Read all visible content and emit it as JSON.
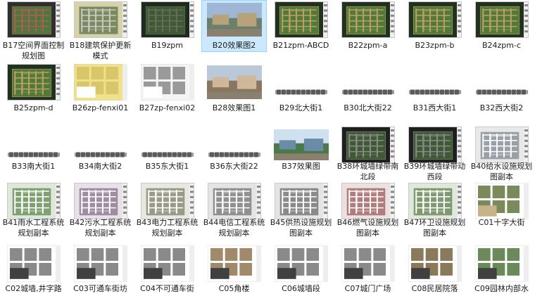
{
  "items": [
    {
      "label": "B17空间界面控制规划图",
      "type": "plan",
      "colors": [
        "#2f2f2f",
        "#4a7a3a",
        "#b05a5a"
      ]
    },
    {
      "label": "B18建筑保护更新模式",
      "type": "plan",
      "colors": [
        "#d8d2a8",
        "#7a8a5a",
        "#c9c9c9"
      ]
    },
    {
      "label": "B19zpm",
      "type": "plan",
      "colors": [
        "#1f2a1f",
        "#3c5a34",
        "#6b6b5a"
      ]
    },
    {
      "label": "B20效果图2",
      "type": "photo",
      "colors": [
        "#9eb7d6",
        "#6b7f6a",
        "#b8a27c"
      ]
    },
    {
      "label": "B21zpm-ABCD",
      "type": "plan",
      "colors": [
        "#22301f",
        "#4f7a3c",
        "#c0a060"
      ]
    },
    {
      "label": "B22zpm-a",
      "type": "plan",
      "colors": [
        "#22301f",
        "#4f7a3c",
        "#c0a060"
      ]
    },
    {
      "label": "B23zpm-b",
      "type": "plan",
      "colors": [
        "#22301f",
        "#4f7a3c",
        "#c0a060"
      ]
    },
    {
      "label": "B24zpm-c",
      "type": "plan",
      "colors": [
        "#22301f",
        "#4f7a3c",
        "#c0a060"
      ]
    },
    {
      "label": "B25zpm-d",
      "type": "plan",
      "colors": [
        "#22301f",
        "#4f7a3c",
        "#c0a060"
      ]
    },
    {
      "label": "B26zp-fenxi01",
      "type": "doc",
      "colors": [
        "#f1e08a",
        "#d9c56a",
        "#ffffff"
      ]
    },
    {
      "label": "B27zp-fenxi02",
      "type": "doc",
      "colors": [
        "#f4f4f4",
        "#9a9a9a",
        "#ffffff"
      ]
    },
    {
      "label": "B28效果图1",
      "type": "photo",
      "colors": [
        "#b9c9d9",
        "#8a7560",
        "#cfb89a"
      ]
    },
    {
      "label": "B29北大街1",
      "type": "strip",
      "colors": [
        "#ffffff",
        "#9a9a9a",
        "#5a5a5a"
      ]
    },
    {
      "label": "B30北大街22",
      "type": "strip",
      "colors": [
        "#ffffff",
        "#9a9a9a",
        "#5a5a5a"
      ]
    },
    {
      "label": "B31西大街1",
      "type": "strip",
      "colors": [
        "#ffffff",
        "#9a9a9a",
        "#5a5a5a"
      ]
    },
    {
      "label": "B32西大街2",
      "type": "strip",
      "colors": [
        "#ffffff",
        "#9a9a9a",
        "#5a5a5a"
      ]
    },
    {
      "label": "B33南大街1",
      "type": "strip",
      "colors": [
        "#ffffff",
        "#9a9a9a",
        "#5a5a5a"
      ]
    },
    {
      "label": "B34南大街2",
      "type": "strip",
      "colors": [
        "#ffffff",
        "#9a9a9a",
        "#5a5a5a"
      ]
    },
    {
      "label": "B35东大街1",
      "type": "strip",
      "colors": [
        "#ffffff",
        "#9a9a9a",
        "#5a5a5a"
      ]
    },
    {
      "label": "B36东大街22",
      "type": "strip",
      "colors": [
        "#ffffff",
        "#9a9a9a",
        "#5a5a5a"
      ]
    },
    {
      "label": "B37效果图",
      "type": "photo",
      "colors": [
        "#cfe0ee",
        "#4a7a4a",
        "#6a8ca8"
      ]
    },
    {
      "label": "B38环城墙绿带南北段",
      "type": "plan",
      "colors": [
        "#1f1f1f",
        "#3e5a34",
        "#8a8a8a"
      ]
    },
    {
      "label": "B39环城墙绿带动西段",
      "type": "plan",
      "colors": [
        "#1f1f1f",
        "#3e5a34",
        "#8a8a8a"
      ]
    },
    {
      "label": "B40给水设施规划图副本",
      "type": "plan",
      "colors": [
        "#e8e8e8",
        "#9aa0a8",
        "#ffffff"
      ]
    },
    {
      "label": "B41雨水工程系统规划副本",
      "type": "plan",
      "colors": [
        "#dfe8d8",
        "#7fa070",
        "#ffffff"
      ]
    },
    {
      "label": "B42污水工程系统规划副本",
      "type": "plan",
      "colors": [
        "#e8e0e8",
        "#a08ca0",
        "#ffffff"
      ]
    },
    {
      "label": "B43电力工程系统规划副本",
      "type": "plan",
      "colors": [
        "#e8e8e0",
        "#9a9a88",
        "#ffffff"
      ]
    },
    {
      "label": "B44电信工程系统规划副本",
      "type": "plan",
      "colors": [
        "#e4e4e4",
        "#909090",
        "#ffffff"
      ]
    },
    {
      "label": "B45供热设施规划图副本",
      "type": "plan",
      "colors": [
        "#e4e4e4",
        "#8a8a8a",
        "#ffffff"
      ]
    },
    {
      "label": "B46燃气设施规划图副本",
      "type": "plan",
      "colors": [
        "#ece0e0",
        "#b07c7c",
        "#ffffff"
      ]
    },
    {
      "label": "B47环卫设施规划图副本",
      "type": "plan",
      "colors": [
        "#e0e8dc",
        "#7f9a70",
        "#ffffff"
      ]
    },
    {
      "label": "C01十字大街",
      "type": "doc",
      "colors": [
        "#ffffff",
        "#7a8a5a",
        "#c8b28a"
      ]
    },
    {
      "label": "C02城墙,井字路",
      "type": "doc",
      "colors": [
        "#ffffff",
        "#8a8a8a",
        "#404040"
      ]
    },
    {
      "label": "C03可通车街坊",
      "type": "doc",
      "colors": [
        "#ffffff",
        "#8a8a8a",
        "#404040"
      ]
    },
    {
      "label": "C04不可通车街",
      "type": "doc",
      "colors": [
        "#ffffff",
        "#8a8a8a",
        "#404040"
      ]
    },
    {
      "label": "C05角楼",
      "type": "doc",
      "colors": [
        "#ffffff",
        "#a08a6a",
        "#404040"
      ]
    },
    {
      "label": "C06城墙段",
      "type": "doc",
      "colors": [
        "#ffffff",
        "#8a8a8a",
        "#404040"
      ]
    },
    {
      "label": "C07城门广场",
      "type": "doc",
      "colors": [
        "#ffffff",
        "#8a8a8a",
        "#404040"
      ]
    },
    {
      "label": "C08民居院落",
      "type": "doc",
      "colors": [
        "#ffffff",
        "#8a7a5a",
        "#404040"
      ]
    },
    {
      "label": "C09园林内部水",
      "type": "doc",
      "colors": [
        "#ffffff",
        "#6a8a5a",
        "#404040"
      ]
    }
  ],
  "selected_index": 3
}
